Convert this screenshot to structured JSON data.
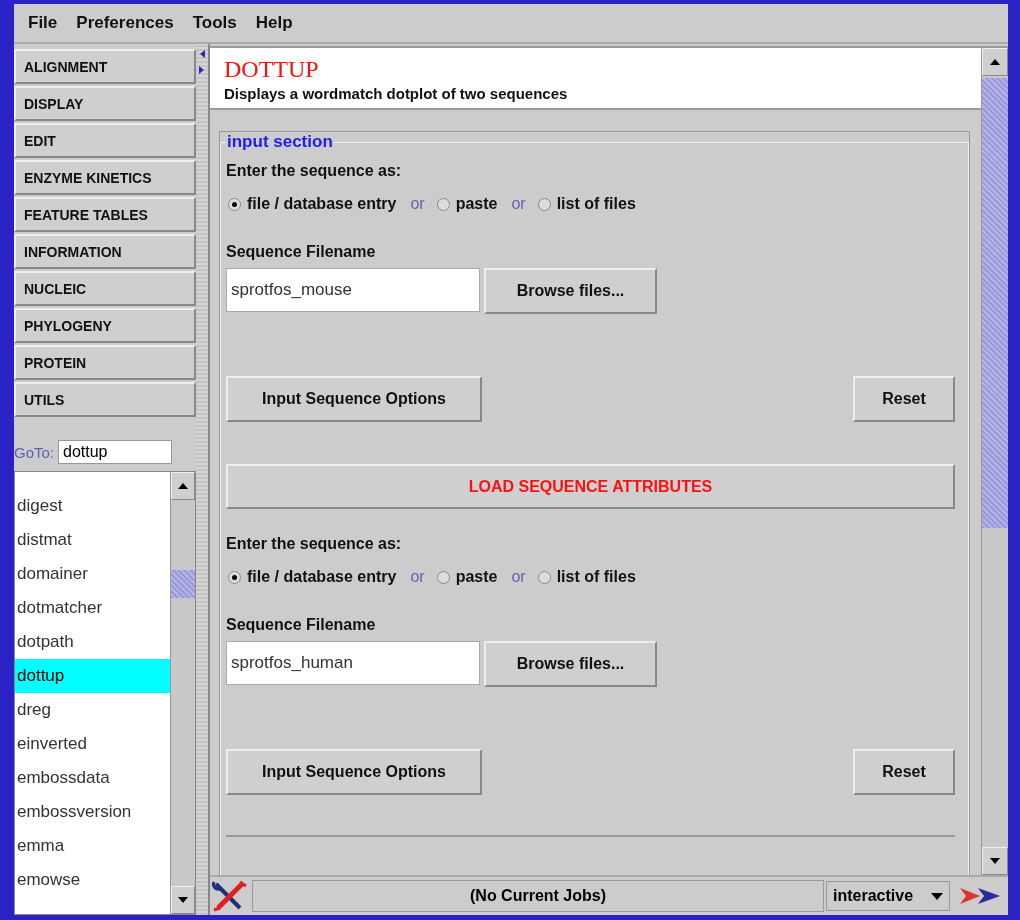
{
  "menu": [
    "File",
    "Preferences",
    "Tools",
    "Help"
  ],
  "categories": [
    "ALIGNMENT",
    "DISPLAY",
    "EDIT",
    "ENZYME KINETICS",
    "FEATURE TABLES",
    "INFORMATION",
    "NUCLEIC",
    "PHYLOGENY",
    "PROTEIN",
    "UTILS"
  ],
  "goto": {
    "label": "GoTo:",
    "value": "dottup"
  },
  "programs": [
    {
      "label": "digest",
      "selected": false
    },
    {
      "label": "distmat",
      "selected": false
    },
    {
      "label": "domainer",
      "selected": false
    },
    {
      "label": "dotmatcher",
      "selected": false
    },
    {
      "label": "dotpath",
      "selected": false
    },
    {
      "label": "dottup",
      "selected": true
    },
    {
      "label": "dreg",
      "selected": false
    },
    {
      "label": "einverted",
      "selected": false
    },
    {
      "label": "embossdata",
      "selected": false
    },
    {
      "label": "embossversion",
      "selected": false
    },
    {
      "label": "emma",
      "selected": false
    },
    {
      "label": "emowse",
      "selected": false
    }
  ],
  "header": {
    "title": "DOTTUP",
    "description": "Displays a wordmatch dotplot of two sequences"
  },
  "section": {
    "legend": "input section",
    "sequences": [
      {
        "prompt": "Enter the sequence as:",
        "options": [
          {
            "label": "file / database entry",
            "selected": true
          },
          {
            "label": "paste",
            "selected": false
          },
          {
            "label": "list of files",
            "selected": false
          }
        ],
        "joiners": [
          "or",
          "or"
        ],
        "filename_label": "Sequence Filename",
        "filename": "sprotfos_mouse",
        "browse": "Browse files...",
        "options_button": "Input Sequence Options",
        "reset": "Reset"
      },
      {
        "prompt": "Enter the sequence as:",
        "options": [
          {
            "label": "file / database entry",
            "selected": true
          },
          {
            "label": "paste",
            "selected": false
          },
          {
            "label": "list of files",
            "selected": false
          }
        ],
        "joiners": [
          "or",
          "or"
        ],
        "filename_label": "Sequence Filename",
        "filename": "sprotfos_human",
        "browse": "Browse files...",
        "options_button": "Input Sequence Options",
        "reset": "Reset"
      }
    ],
    "load_button": "LOAD SEQUENCE ATTRIBUTES"
  },
  "status_bar": {
    "jobs": "(No Current Jobs)",
    "mode": "interactive"
  }
}
